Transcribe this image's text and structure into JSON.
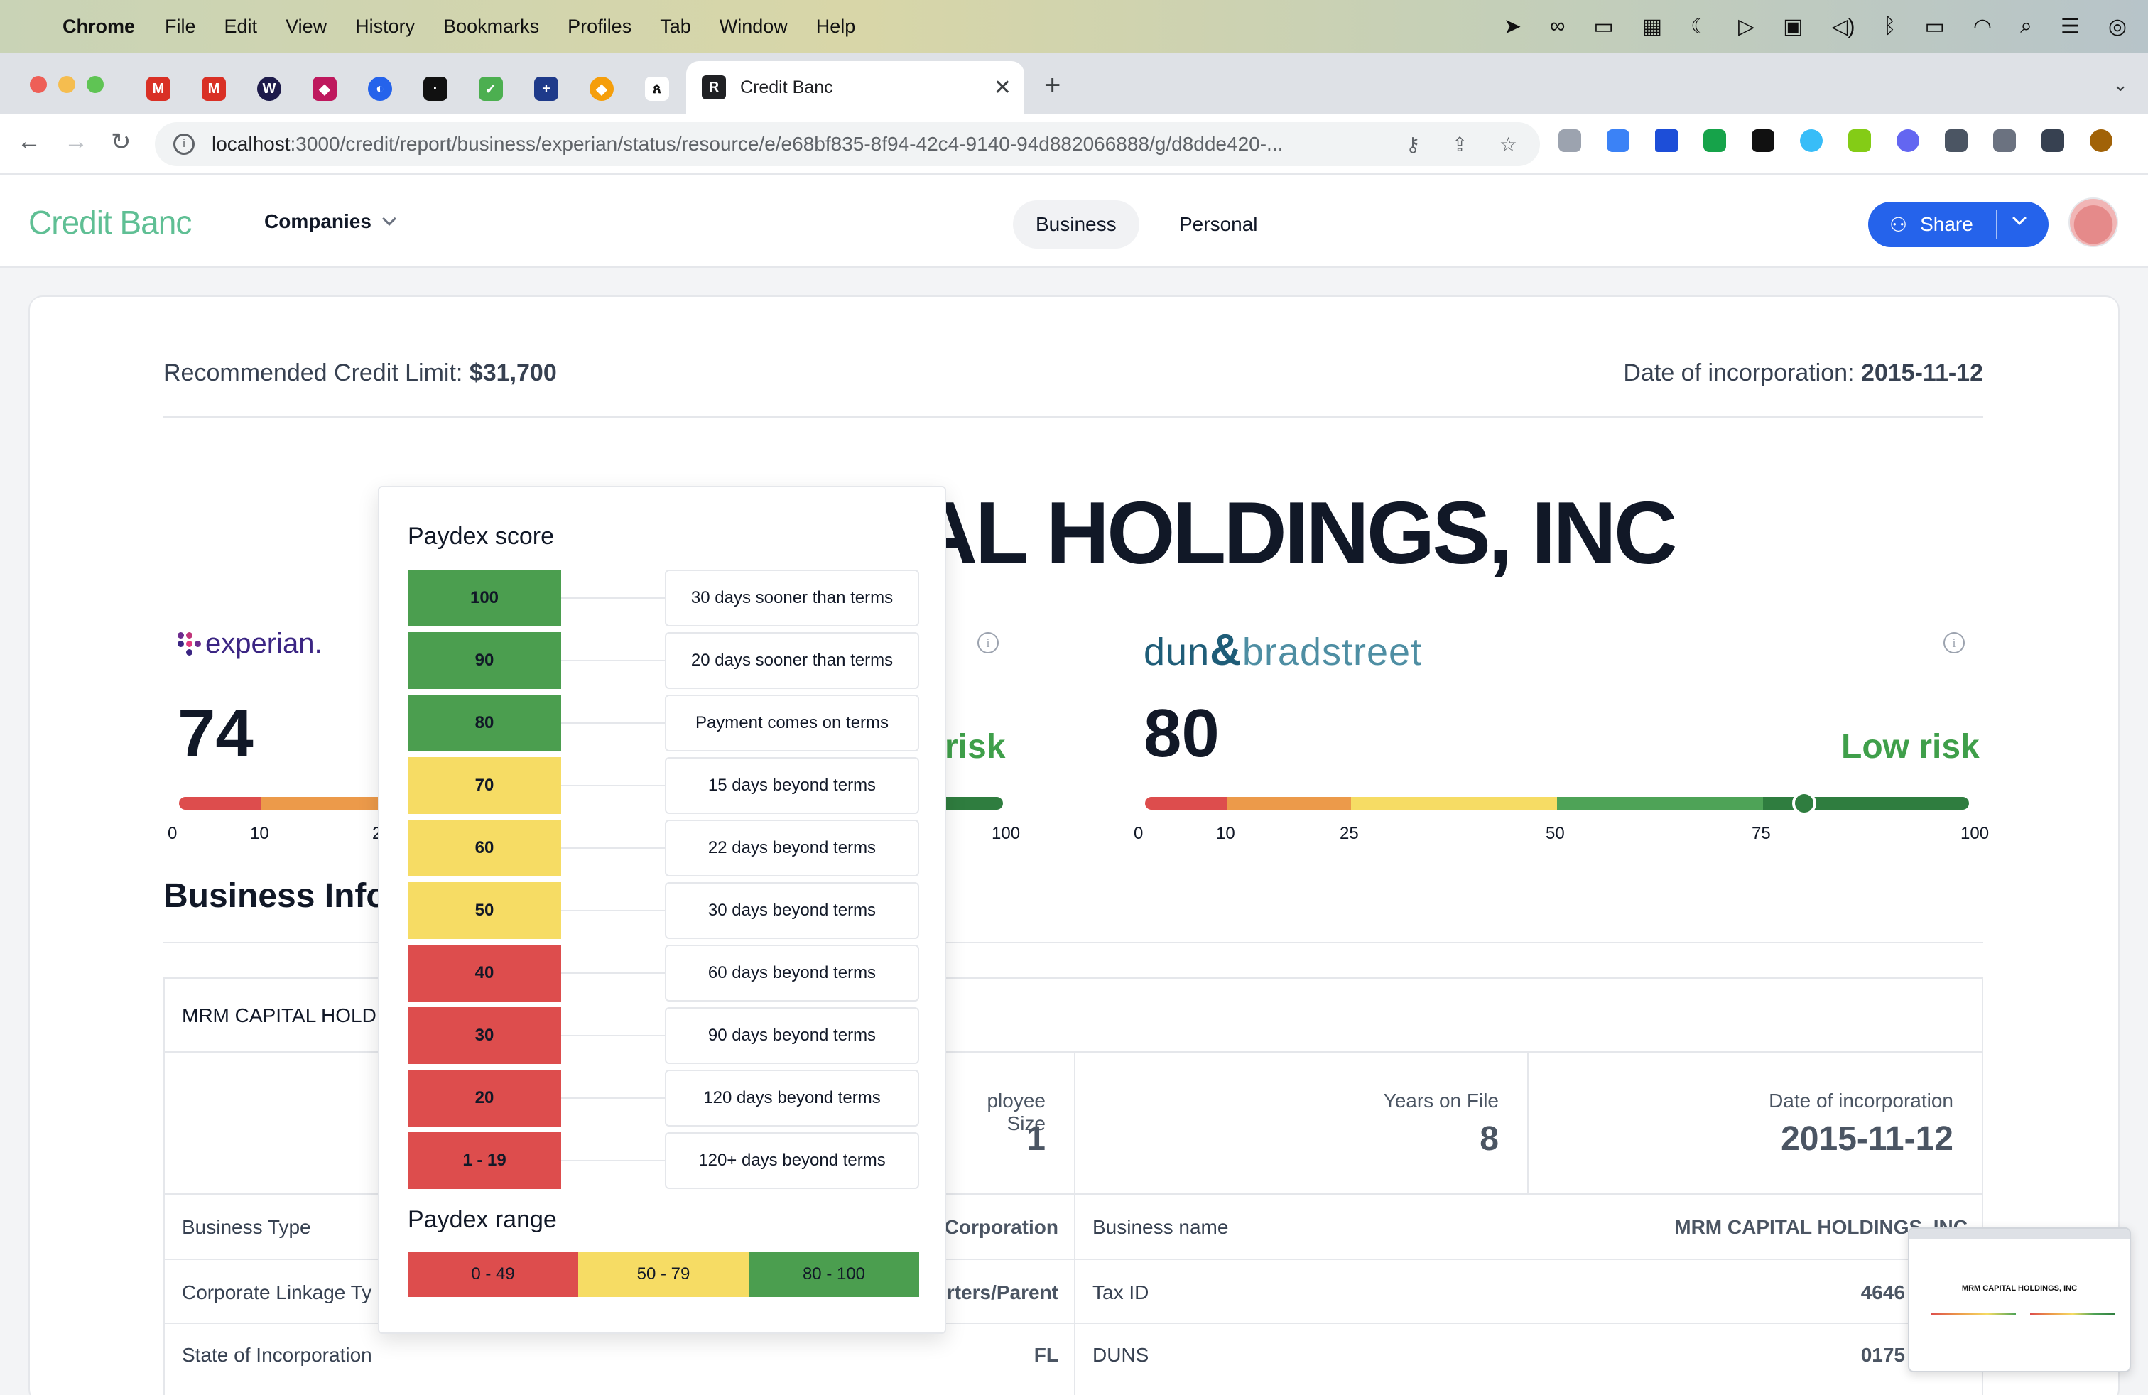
{
  "menubar": {
    "app": "Chrome",
    "items": [
      "File",
      "Edit",
      "View",
      "History",
      "Bookmarks",
      "Profiles",
      "Tab",
      "Window",
      "Help"
    ]
  },
  "browser": {
    "active_tab_title": "Credit Banc",
    "url_host": "localhost",
    "url_rest": ":3000/credit/report/business/experian/status/resource/e/e68bf835-8f94-42c4-9140-94d882066888/g/d8dde420-..."
  },
  "header": {
    "logo": "Credit Banc",
    "companies_label": "Companies",
    "tabs": [
      "Business",
      "Personal"
    ],
    "share_label": "Share"
  },
  "summary": {
    "credit_limit_label": "Recommended Credit Limit:",
    "credit_limit_value": "$31,700",
    "incorporation_label": "Date of incorporation:",
    "incorporation_value": "2015-11-12",
    "company_name_visible": "TAL HOLDINGS, INC"
  },
  "bureaus": {
    "experian": {
      "logo": "experian.",
      "score": "74",
      "ticks": [
        "0",
        "10",
        "2"
      ]
    },
    "middle": {
      "risk": "risk",
      "tick_end": "100"
    },
    "dnb": {
      "logo_a": "dun",
      "logo_amp": "&",
      "logo_b": "bradstreet",
      "score": "80",
      "risk": "Low risk",
      "ticks": [
        "0",
        "10",
        "25",
        "50",
        "75",
        "100"
      ],
      "gauge_value": 80
    }
  },
  "business_info": {
    "title": "Business Info",
    "company_row": "MRM CAPITAL HOLDI",
    "stats": [
      {
        "label": "ployee Size",
        "value": "1"
      },
      {
        "label": "Years on File",
        "value": "8"
      },
      {
        "label": "Date of incorporation",
        "value": "2015-11-12"
      }
    ],
    "rows": [
      {
        "left_label": "Business Type",
        "left_value": "Corporation",
        "right_label": "Business name",
        "right_value": "MRM CAPITAL HOLDINGS, INC"
      },
      {
        "left_label": "Corporate Linkage Ty",
        "left_value": "rters/Parent",
        "right_label": "Tax ID",
        "right_value": "4646"
      },
      {
        "left_label": "State of Incorporation",
        "left_value": "FL",
        "right_label": "DUNS",
        "right_value": "0175"
      }
    ]
  },
  "paydex_popup": {
    "title": "Paydex score",
    "rows": [
      {
        "score": "100",
        "desc": "30 days sooner than terms",
        "color": "#4b9e4f"
      },
      {
        "score": "90",
        "desc": "20 days sooner than terms",
        "color": "#4b9e4f"
      },
      {
        "score": "80",
        "desc": "Payment comes on terms",
        "color": "#4b9e4f"
      },
      {
        "score": "70",
        "desc": "15 days beyond terms",
        "color": "#f6dc64"
      },
      {
        "score": "60",
        "desc": "22 days beyond terms",
        "color": "#f6dc64"
      },
      {
        "score": "50",
        "desc": "30 days beyond terms",
        "color": "#f6dc64"
      },
      {
        "score": "40",
        "desc": "60 days beyond terms",
        "color": "#dd4d4d"
      },
      {
        "score": "30",
        "desc": "90 days beyond terms",
        "color": "#dd4d4d"
      },
      {
        "score": "20",
        "desc": "120 days beyond terms",
        "color": "#dd4d4d"
      },
      {
        "score": "1 - 19",
        "desc": "120+ days beyond terms",
        "color": "#dd4d4d"
      }
    ],
    "range_title": "Paydex range",
    "ranges": [
      {
        "label": "0 - 49",
        "color": "#dd4d4d"
      },
      {
        "label": "50 - 79",
        "color": "#f6dc64"
      },
      {
        "label": "80 - 100",
        "color": "#4b9e4f"
      }
    ]
  },
  "thumbnail": {
    "title": "MRM CAPITAL HOLDINGS, INC"
  },
  "colors": {
    "brand": "#5fbf94",
    "primary_button": "#2563eb",
    "low_risk": "#3f9f4a",
    "gauge_red": "#dd4d4d",
    "gauge_orange": "#ec9a4a",
    "gauge_yellow": "#f6dc64",
    "gauge_green": "#4ea357",
    "gauge_dark_green": "#2f7d3f"
  }
}
